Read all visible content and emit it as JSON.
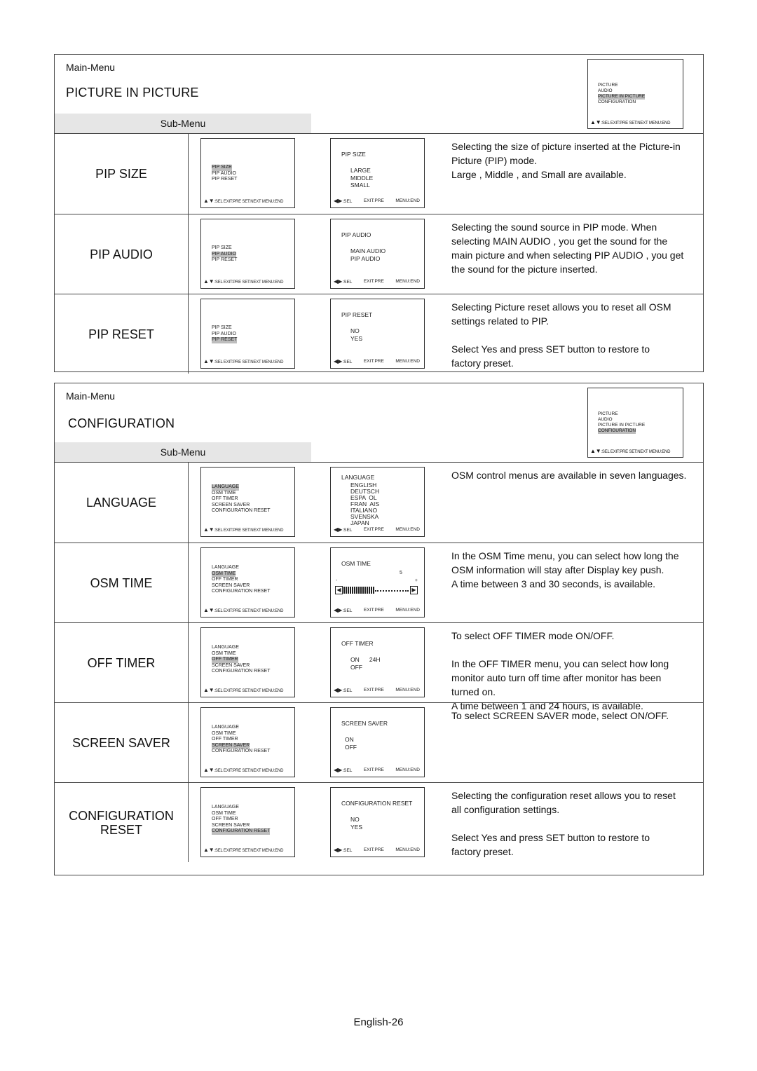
{
  "page_number": "English-26",
  "osm_footer_main": ":SEL EXIT:PRE SET:NEXT MENU:END",
  "osm_footer_sub": {
    "sel": ":SEL",
    "exit": "EXIT:PRE",
    "menu": "MENU:END"
  },
  "pip": {
    "main_menu_label": "Main-Menu",
    "title": "PICTURE IN PICTURE",
    "sub_menu_label": "Sub-Menu",
    "main_menu_items": [
      "PICTURE",
      "AUDIO",
      "PICTURE IN PICTURE",
      "CONFIGURATION"
    ],
    "main_menu_selected": 2,
    "sub_items": [
      "PIP SIZE",
      "PIP AUDIO",
      "PIP RESET"
    ],
    "rows": [
      {
        "label": "PIP SIZE",
        "selected": 0,
        "sub_title": "PIP SIZE",
        "options": [
          "LARGE",
          "MIDDLE",
          "SMALL"
        ],
        "description": "Selecting the size of picture inserted at the  Picture-in\nPicture  (PIP) mode.\n Large ,  Middle , and  Small  are available."
      },
      {
        "label": "PIP AUDIO",
        "selected": 1,
        "sub_title": "PIP AUDIO",
        "options": [
          "MAIN AUDIO",
          "PIP AUDIO"
        ],
        "description": "Selecting the sound source in PIP mode.  When\nselecting  MAIN AUDIO , you get the sound for the\nmain picture and when selecting  PIP AUDIO , you get\nthe sound for the picture inserted."
      },
      {
        "label": "PIP RESET",
        "selected": 2,
        "sub_title": "PIP RESET",
        "options": [
          "NO",
          "YES"
        ],
        "description": "Selecting Picture reset allows you to reset all OSM\nsettings related to PIP.\n\nSelect  Yes  and press  SET  button to restore to\nfactory preset."
      }
    ]
  },
  "config": {
    "main_menu_label": "Main-Menu",
    "title": "CONFIGURATION",
    "sub_menu_label": "Sub-Menu",
    "main_menu_items": [
      "PICTURE",
      "AUDIO",
      "PICTURE IN PICTURE",
      "CONFIGURATION"
    ],
    "main_menu_selected": 3,
    "sub_items": [
      "LANGUAGE",
      "OSM TIME",
      "OFF TIMER",
      "SCREEN SAVER",
      "CONFIGURATION RESET"
    ],
    "rows": [
      {
        "label": "LANGUAGE",
        "selected": 0,
        "sub_title": "LANGUAGE",
        "options": [
          "ENGLISH",
          "DEUTSCH",
          "ESPA  OL",
          "FRAN  AIS",
          "ITALIANO",
          "SVENSKA",
          "JAPAN"
        ],
        "description": "OSM control menus are available in seven languages."
      },
      {
        "label": "OSM TIME",
        "selected": 1,
        "sub_title": "OSM TIME",
        "slider": {
          "value": "5",
          "minus": "-",
          "plus": "+",
          "fill_fraction": 0.47
        },
        "description": "In the OSM Time menu, you can select how long the\nOSM information will stay after Display key push.\nA time between 3 and 30 seconds, is available."
      },
      {
        "label": "OFF TIMER",
        "selected": 2,
        "sub_title": "OFF TIMER",
        "options": [
          "ON      24H",
          "OFF"
        ],
        "description": "To select OFF TIMER mode ON/OFF.\n\nIn the OFF TIMER menu, you can select how long\nmonitor auto turn off time after monitor has been\nturned on.\nA time between 1 and 24 hours, is available."
      },
      {
        "label": "SCREEN SAVER",
        "selected": 3,
        "sub_title": "SCREEN SAVER",
        "options": [
          "ON",
          "OFF"
        ],
        "description": "To select SCREEN SAVER mode, select ON/OFF."
      },
      {
        "label": "CONFIGURATION\nRESET",
        "selected": 4,
        "sub_title": "CONFIGURATION RESET",
        "options": [
          "NO",
          "YES"
        ],
        "description": "Selecting the configuration reset allows you to reset\nall configuration settings.\n\nSelect  Yes  and press  SET  button to restore to\nfactory preset."
      }
    ]
  }
}
